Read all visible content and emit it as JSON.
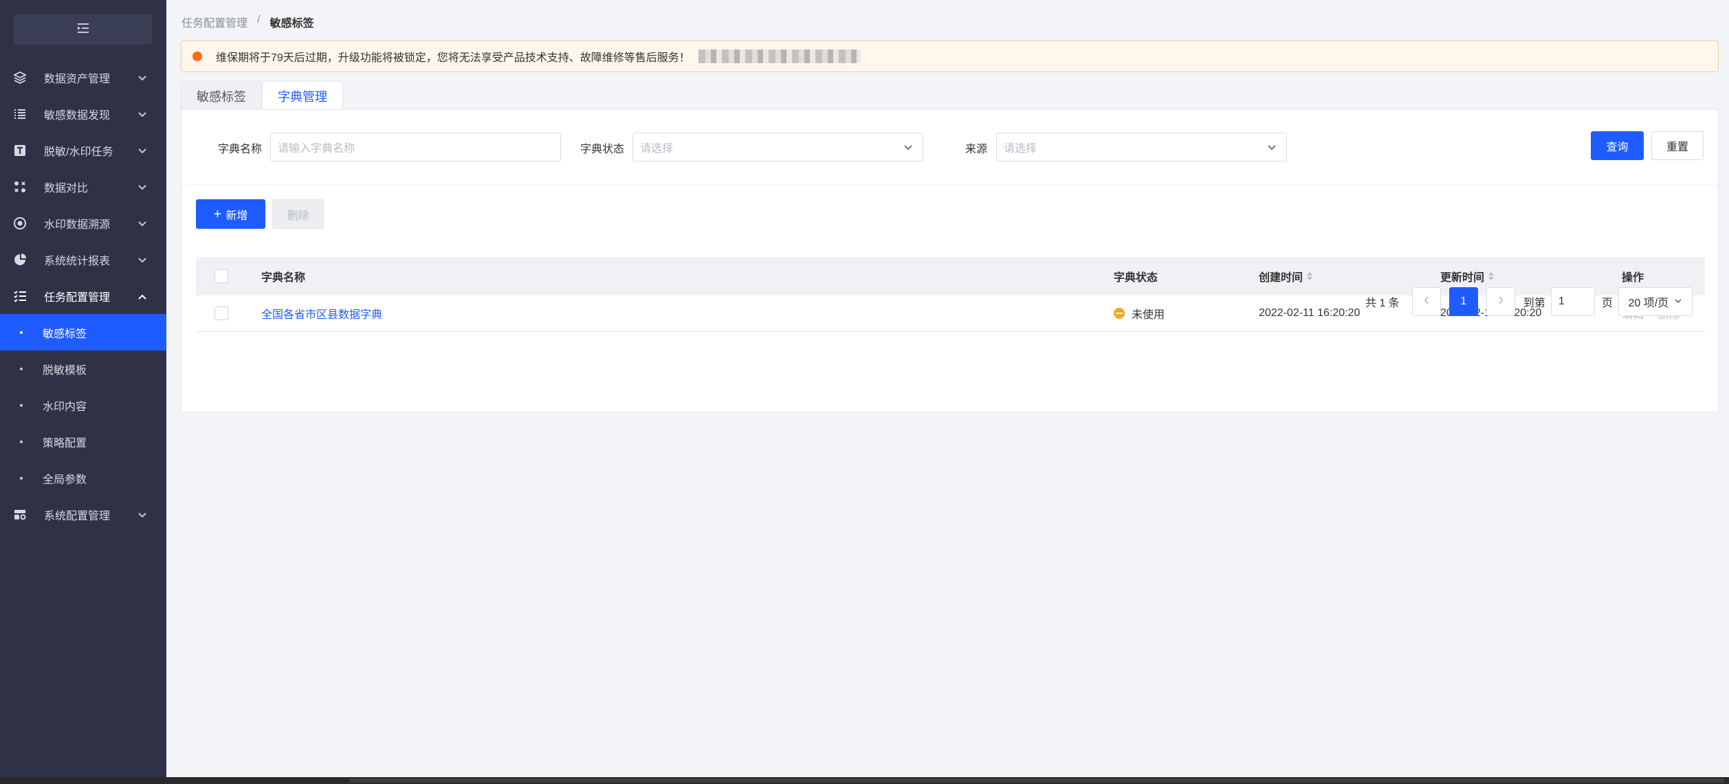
{
  "sidebar": {
    "collapse_icon": "menu-fold-icon",
    "items": [
      {
        "label": "数据资产管理",
        "icon": "layers-icon"
      },
      {
        "label": "敏感数据发现",
        "icon": "list-icon"
      },
      {
        "label": "脱敏/水印任务",
        "icon": "text-t-icon"
      },
      {
        "label": "数据对比",
        "icon": "compare-icon"
      },
      {
        "label": "水印数据溯源",
        "icon": "target-icon"
      },
      {
        "label": "系统统计报表",
        "icon": "pie-icon"
      },
      {
        "label": "任务配置管理",
        "icon": "checklist-icon"
      },
      {
        "label": "系统配置管理",
        "icon": "settings-box-icon"
      }
    ],
    "sub_items": [
      {
        "label": "敏感标签"
      },
      {
        "label": "脱敏模板"
      },
      {
        "label": "水印内容"
      },
      {
        "label": "策略配置"
      },
      {
        "label": "全局参数"
      }
    ]
  },
  "breadcrumb": {
    "parent": "任务配置管理",
    "sep": "/",
    "current": "敏感标签"
  },
  "alert": {
    "text": "维保期将于79天后过期，升级功能将被锁定，您将无法享受产品技术支持、故障维修等售后服务！",
    "color": "#ff6a1a"
  },
  "tabs": [
    {
      "label": "敏感标签"
    },
    {
      "label": "字典管理"
    }
  ],
  "filters": {
    "name_label": "字典名称",
    "name_placeholder": "请输入字典名称",
    "status_label": "字典状态",
    "status_placeholder": "请选择",
    "source_label": "来源",
    "source_placeholder": "请选择",
    "query": "查询",
    "reset": "重置"
  },
  "actions": {
    "add": "新增",
    "delete": "删除"
  },
  "table": {
    "columns": {
      "name": "字典名称",
      "status": "字典状态",
      "created": "创建时间",
      "updated": "更新时间",
      "ops": "操作"
    },
    "rows": [
      {
        "name": "全国各省市区县数据字典",
        "status": "未使用",
        "created": "2022-02-11 16:20:20",
        "updated": "2022-02-11 16:20:20",
        "edit": "编辑",
        "delete": "删除"
      }
    ]
  },
  "pagination": {
    "total": "共 1 条",
    "page": "1",
    "goto": "到第",
    "goto_value": "1",
    "page_suffix": "页",
    "size": "20 项/页"
  },
  "colors": {
    "primary": "#1f5cff",
    "sidebar_bg": "#2f3247",
    "warning": "#f5a623"
  }
}
